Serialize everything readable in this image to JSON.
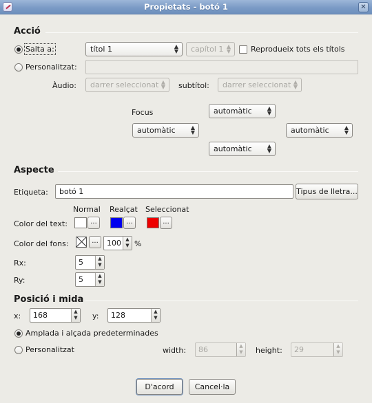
{
  "window": {
    "title": "Propietats - botó 1",
    "close_glyph": "✕"
  },
  "accio": {
    "heading": "Acció",
    "salta_label": "Salta a:",
    "title_combo": "títol 1",
    "chapter_combo": "capítol 1",
    "play_all_label": "Reprodueix tots els títols",
    "personalitzat_label": "Personalitzat:",
    "custom_value": "",
    "audio_label": "Àudio:",
    "audio_combo": "darrer seleccionat",
    "subtitle_label": "subtítol:",
    "subtitle_combo": "darrer seleccionat"
  },
  "focus": {
    "label": "Focus",
    "up": "automàtic",
    "left": "automàtic",
    "right": "automàtic",
    "down": "automàtic"
  },
  "aspecte": {
    "heading": "Aspecte",
    "label_label": "Etiqueta:",
    "label_value": "botó 1",
    "font_button": "Tipus de lletra...",
    "col_normal": "Normal",
    "col_highlighted": "Realçat",
    "col_selected": "Seleccionat",
    "text_color_label": "Color del text:",
    "text_colors": {
      "normal": "#ffffff",
      "highlighted": "#0000ee",
      "selected": "#ee0000"
    },
    "dots": "...",
    "bg_color_label": "Color del fons:",
    "bg_opacity": "100",
    "percent": "%",
    "rx_label": "Rx:",
    "rx_value": "5",
    "ry_label": "Ry:",
    "ry_value": "5"
  },
  "posicio": {
    "heading": "Posició i mida",
    "x_label": "x:",
    "x_value": "168",
    "y_label": "y:",
    "y_value": "128",
    "default_size_label": "Amplada i alçada predeterminades",
    "custom_label": "Personalitzat",
    "width_label": "width:",
    "width_value": "86",
    "height_label": "height:",
    "height_value": "29"
  },
  "footer": {
    "ok": "D'acord",
    "cancel": "Cancel·la"
  }
}
